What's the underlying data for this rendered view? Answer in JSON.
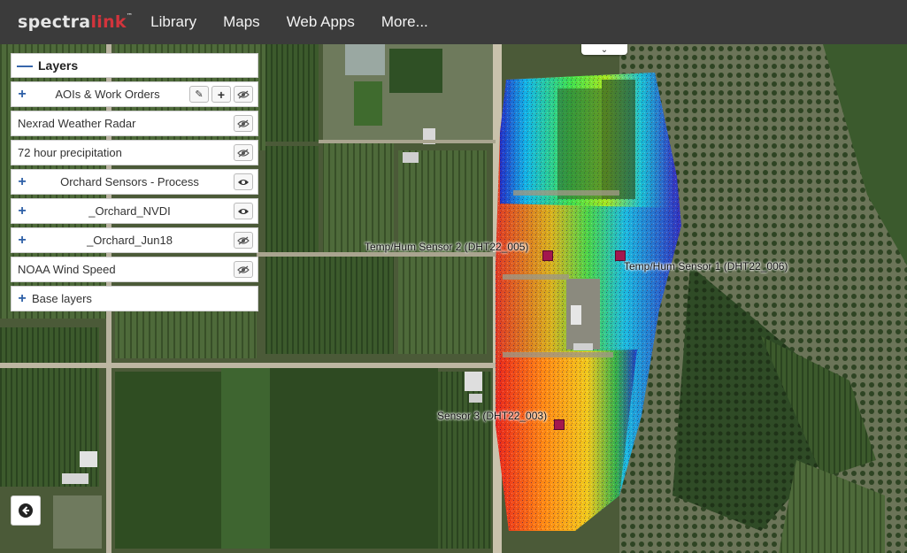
{
  "brand": {
    "name_part1": "spectra",
    "name_part2": "link",
    "trademark": "™"
  },
  "nav": {
    "items": [
      "Library",
      "Maps",
      "Web Apps",
      "More..."
    ]
  },
  "layers_panel": {
    "title": "Layers",
    "items": [
      {
        "label": "AOIs & Work Orders",
        "expandable": true,
        "icons": [
          "pencil-icon",
          "plus-icon",
          "eye-slash-icon"
        ]
      },
      {
        "label": "Nexrad Weather Radar",
        "expandable": false,
        "icons": [
          "eye-slash-icon"
        ]
      },
      {
        "label": "72 hour precipitation",
        "expandable": false,
        "icons": [
          "eye-slash-icon"
        ]
      },
      {
        "label": "Orchard Sensors - Process",
        "expandable": true,
        "icons": [
          "eye-icon"
        ]
      },
      {
        "label": "_Orchard_NVDI",
        "expandable": true,
        "icons": [
          "eye-icon"
        ]
      },
      {
        "label": "_Orchard_Jun18",
        "expandable": true,
        "icons": [
          "eye-slash-icon"
        ]
      },
      {
        "label": "NOAA Wind Speed",
        "expandable": false,
        "icons": [
          "eye-slash-icon"
        ]
      }
    ],
    "base_layers_label": "Base layers"
  },
  "sensors": [
    {
      "label": "Temp/Hum Sensor 2 (DHT22_005)"
    },
    {
      "label": "Temp/Hum Sensor 1 (DHT22_006)"
    },
    {
      "label": "Sensor 3 (DHT22_003)"
    }
  ],
  "colors": {
    "accent": "#d2343c",
    "navbar": "#3b3b3b",
    "marker": "#a3174e",
    "panel_icon": "#2d5fa7"
  }
}
